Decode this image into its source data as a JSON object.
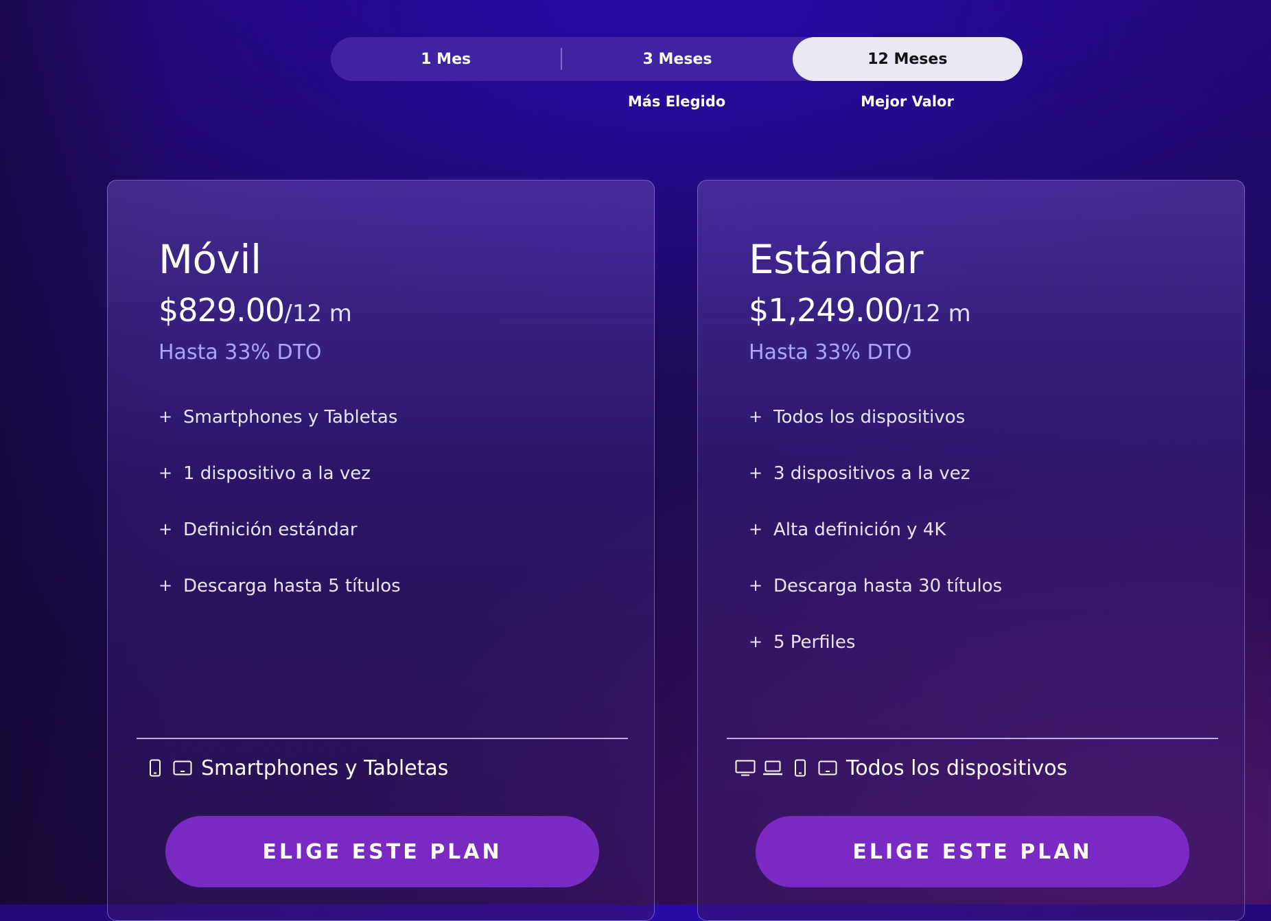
{
  "period_selector": {
    "tabs": [
      {
        "label": "1 Mes",
        "active": false
      },
      {
        "label": "3 Meses",
        "active": false
      },
      {
        "label": "12 Meses",
        "active": true
      }
    ],
    "badges": [
      {
        "label": "Más Elegido"
      },
      {
        "label": "Mejor Valor"
      }
    ]
  },
  "plans": [
    {
      "name": "Móvil",
      "price": "$829.00",
      "period": "/12 m",
      "discount": "Hasta 33% DTO",
      "features": [
        "Smartphones y Tabletas",
        "1 dispositivo a la vez",
        "Definición estándar",
        "Descarga hasta 5 títulos"
      ],
      "device_icons": [
        "smartphone-icon",
        "tablet-icon"
      ],
      "devices_label": "Smartphones y Tabletas",
      "button_label": "ELIGE ESTE PLAN"
    },
    {
      "name": "Estándar",
      "price": "$1,249.00",
      "period": "/12 m",
      "discount": "Hasta 33% DTO",
      "features": [
        "Todos los dispositivos",
        "3 dispositivos a la vez",
        "Alta definición y 4K",
        "Descarga hasta 30 títulos",
        "5 Perfiles"
      ],
      "device_icons": [
        "tv-icon",
        "laptop-icon",
        "smartphone-icon",
        "tablet-icon"
      ],
      "devices_label": "Todos los dispositivos",
      "button_label": "ELIGE ESTE PLAN"
    }
  ],
  "colors": {
    "background": "#1d0a5e",
    "tab_bar": "#3f23a3",
    "tab_active": "#ebe8f4",
    "discount_text": "#a8a6ff",
    "button": "#7a2ac2"
  }
}
